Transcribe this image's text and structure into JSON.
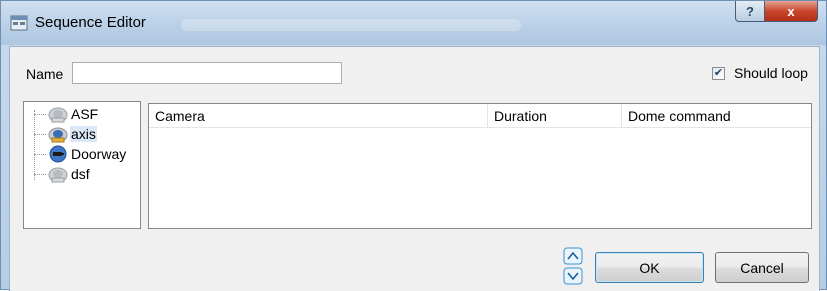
{
  "window": {
    "title": "Sequence Editor"
  },
  "caption_buttons": {
    "help": "?",
    "close": "x"
  },
  "form": {
    "name_label": "Name",
    "name_value": "",
    "loop_checked": true,
    "loop_label": "Should loop"
  },
  "camera_tree": {
    "items": [
      {
        "label": "ASF",
        "icon": "dome-camera-icon",
        "selected": false
      },
      {
        "label": "axis",
        "icon": "dome-camera-icon",
        "selected": true
      },
      {
        "label": "Doorway",
        "icon": "box-camera-icon",
        "selected": false
      },
      {
        "label": "dsf",
        "icon": "dome-camera-icon",
        "selected": false
      }
    ]
  },
  "sequence_table": {
    "columns": [
      "Camera",
      "Duration",
      "Dome command"
    ],
    "rows": []
  },
  "buttons": {
    "ok": "OK",
    "cancel": "Cancel"
  },
  "icons": [
    "window-icon",
    "move-up-icon",
    "move-down-icon"
  ],
  "colors": {
    "accent": "#3c7fb1",
    "close": "#c9472c",
    "selection": "#dbe8f7"
  }
}
